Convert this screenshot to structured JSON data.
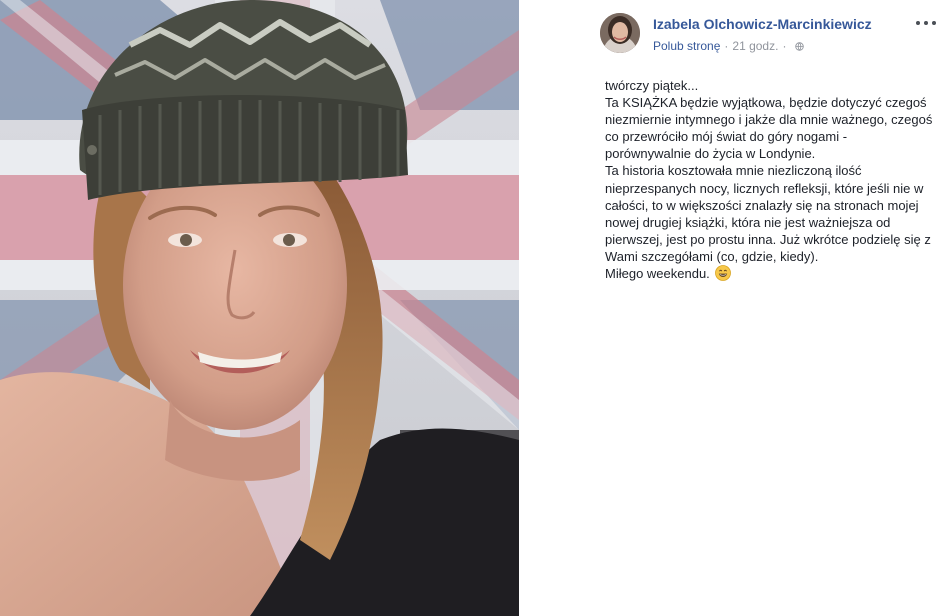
{
  "photo": {
    "description_icon": "selfie-photo"
  },
  "post": {
    "author": "Izabela Olchowicz-Marcinkiewicz",
    "like_page_label": "Polub stronę",
    "separator": "·",
    "timestamp": "21 godz.",
    "privacy_icon": "globe-icon",
    "more_icon": "more-options-icon",
    "lines": [
      "twórczy piątek...",
      "Ta KSIĄŻKA będzie wyjątkowa, będzie dotyczyć czegoś niezmiernie intymnego i jakże dla mnie ważnego, czegoś co przewróciło mój świat do góry nogami - porównywalnie do życia w Londynie.",
      "Ta historia kosztowała mnie niezliczoną ilość nieprzespanych nocy, licznych refleksji, które jeśli nie w całości, to w większości znalazły się na stronach mojej nowej drugiej książki, która nie jest ważniejsza od pierwszej, jest po prostu inna. Już wkrótce podzielę się z Wami szczegółami (co, gdzie, kiedy).",
      "Miłego weekendu."
    ],
    "emoji_icon": "grinning-face-emoji"
  },
  "colors": {
    "link": "#365899",
    "meta": "#90949c",
    "text": "#1d2129"
  }
}
